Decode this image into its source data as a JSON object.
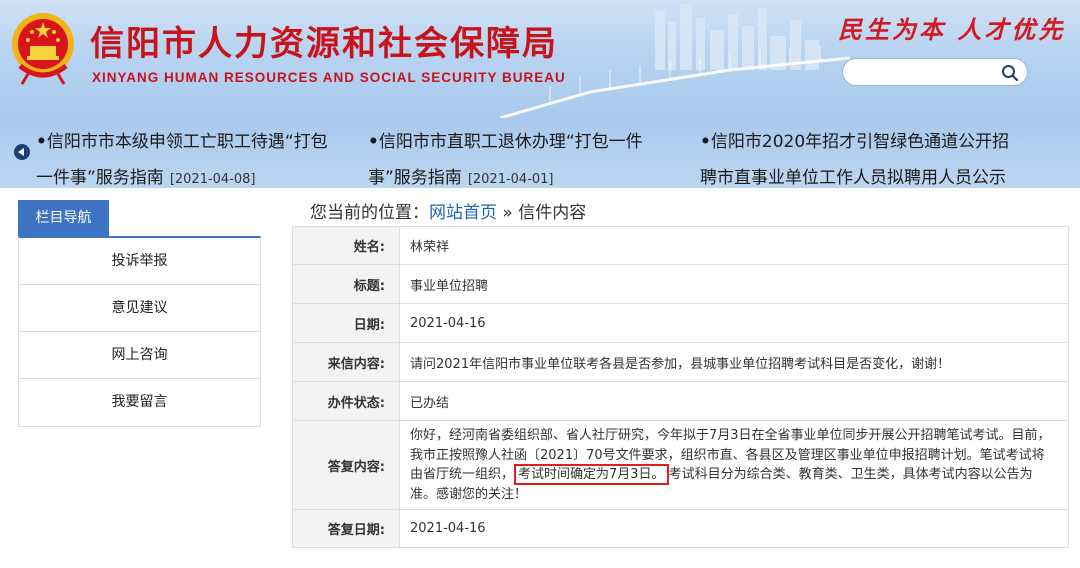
{
  "header": {
    "title": "信阳市人力资源和社会保障局",
    "subtitle": "XINYANG HUMAN RESOURCES AND SOCIAL SECURITY BUREAU",
    "slogan": "民生为本 人才优先",
    "search_placeholder": ""
  },
  "ticker": {
    "items": [
      {
        "title_line1": "信阳市市本级申领工亡职工待遇“打包",
        "title_line2": "一件事”服务指南",
        "date": "[2021-04-08]"
      },
      {
        "title_line1": "信阳市市直职工退休办理“打包一件",
        "title_line2": "事”服务指南",
        "date": "[2021-04-01]"
      },
      {
        "title_line1": "信阳市2020年招才引智绿色通道公开招",
        "title_line2": "聘市直事业单位工作人员拟聘用人员公示",
        "date": ""
      }
    ]
  },
  "nav": {
    "heading": "栏目导航",
    "items": [
      "投诉举报",
      "意见建议",
      "网上咨询",
      "我要留言"
    ]
  },
  "breadcrumb": {
    "prefix": "您当前的位置：",
    "home": "网站首页",
    "separator": " » ",
    "current": "信件内容"
  },
  "letter": {
    "name_label": "姓名:",
    "name": "林荣祥",
    "subject_label": "标题:",
    "subject": "事业单位招聘",
    "date_label": "日期:",
    "date": "2021-04-16",
    "content_label": "来信内容:",
    "content": "请问2021年信阳市事业单位联考各县是否参加，县城事业单位招聘考试科目是否变化，谢谢！",
    "status_label": "办件状态:",
    "status": "已办结",
    "reply_label": "答复内容:",
    "reply_before": "你好，经河南省委组织部、省人社厅研究，今年拟于7月3日在全省事业单位同步开展公开招聘笔试考试。目前，我市正按照豫人社函〔2021〕70号文件要求，组织市直、各县区及管理区事业单位申报招聘计划。笔试考试将由省厅统一组织，",
    "reply_highlight": "考试时间确定为7月3日。",
    "reply_after": "考试科目分为综合类、教育类、卫生类，具体考试内容以公告为准。感谢您的关注！",
    "reply_date_label": "答复日期:",
    "reply_date": "2021-04-16"
  },
  "colors": {
    "brand_red": "#c8131b",
    "nav_blue": "#3e73c4",
    "link_blue": "#1c63b8",
    "highlight_border": "#e02020"
  }
}
